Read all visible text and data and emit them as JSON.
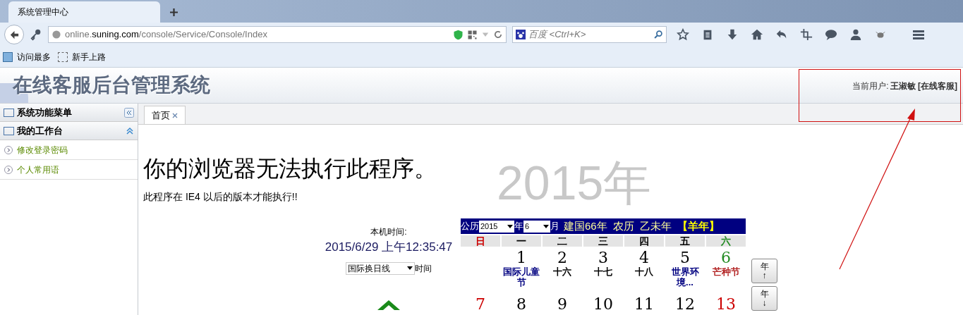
{
  "browser": {
    "tab_title": "系统管理中心",
    "url_prefix": "online.",
    "url_domain": "suning.com",
    "url_path": "/console/Service/Console/Index",
    "search_placeholder": "百度 <Ctrl+K>",
    "bookmarks": [
      "访问最多",
      "新手上路"
    ]
  },
  "header": {
    "title": "在线客服后台管理系统",
    "user_label": "当前用户:",
    "user_name": "王淑敏 [在线客服]"
  },
  "sidebar": {
    "title": "系统功能菜单",
    "section": "我的工作台",
    "expanded": true,
    "items": [
      {
        "label": "修改登录密码"
      },
      {
        "label": "个人常用语"
      }
    ]
  },
  "tabs": [
    {
      "label": "首页",
      "selected": true
    }
  ],
  "content": {
    "heading": "你的浏览器无法执行此程序。",
    "message": "此程序在 IE4 以后的版本才能执行!!",
    "background_year": "2015年"
  },
  "clock": {
    "label": "本机时间:",
    "time": "2015/6/29 上午12:35:47",
    "zone": "国际换日线",
    "zone_suffix": "时间"
  },
  "calendar": {
    "prefix": "公历",
    "year": "2015",
    "year_unit": "年",
    "month": "6",
    "month_unit": "月",
    "info": "建国66年  农历  乙未年",
    "zodiac": "【羊年】",
    "weekdays": [
      {
        "label": "日",
        "color": "#cc0000"
      },
      {
        "label": "一",
        "color": "#000000"
      },
      {
        "label": "二",
        "color": "#000000"
      },
      {
        "label": "三",
        "color": "#000000"
      },
      {
        "label": "四",
        "color": "#000000"
      },
      {
        "label": "五",
        "color": "#000000"
      },
      {
        "label": "六",
        "color": "#228b22"
      }
    ],
    "weeks": [
      [
        {
          "kind": "blank"
        },
        {
          "kind": "day",
          "day": "1",
          "color": "#000000",
          "note": {
            "text": "国际儿童节",
            "color": "#000080"
          }
        },
        {
          "kind": "day",
          "day": "2",
          "color": "#000000",
          "note": {
            "text": "十六",
            "color": "#000000"
          }
        },
        {
          "kind": "day",
          "day": "3",
          "color": "#000000",
          "note": {
            "text": "十七",
            "color": "#000000"
          }
        },
        {
          "kind": "day",
          "day": "4",
          "color": "#000000",
          "note": {
            "text": "十八",
            "color": "#000000"
          }
        },
        {
          "kind": "day",
          "day": "5",
          "color": "#000000",
          "note": {
            "text": "世界环境...",
            "color": "#000080"
          }
        },
        {
          "kind": "day",
          "day": "6",
          "color": "#228b22",
          "note": {
            "text": "芒种节",
            "color": "#b22222"
          }
        }
      ],
      [
        {
          "kind": "day",
          "day": "7",
          "color": "#cc0000"
        },
        {
          "kind": "day",
          "day": "8",
          "color": "#000000"
        },
        {
          "kind": "day",
          "day": "9",
          "color": "#000000"
        },
        {
          "kind": "day",
          "day": "10",
          "color": "#000000"
        },
        {
          "kind": "day",
          "day": "11",
          "color": "#000000"
        },
        {
          "kind": "day",
          "day": "12",
          "color": "#000000"
        },
        {
          "kind": "day",
          "day": "13",
          "color": "#cc0000"
        }
      ]
    ],
    "buttons": [
      {
        "label": "年",
        "arrow": "↑"
      },
      {
        "label": "年",
        "arrow": "↓"
      }
    ]
  }
}
